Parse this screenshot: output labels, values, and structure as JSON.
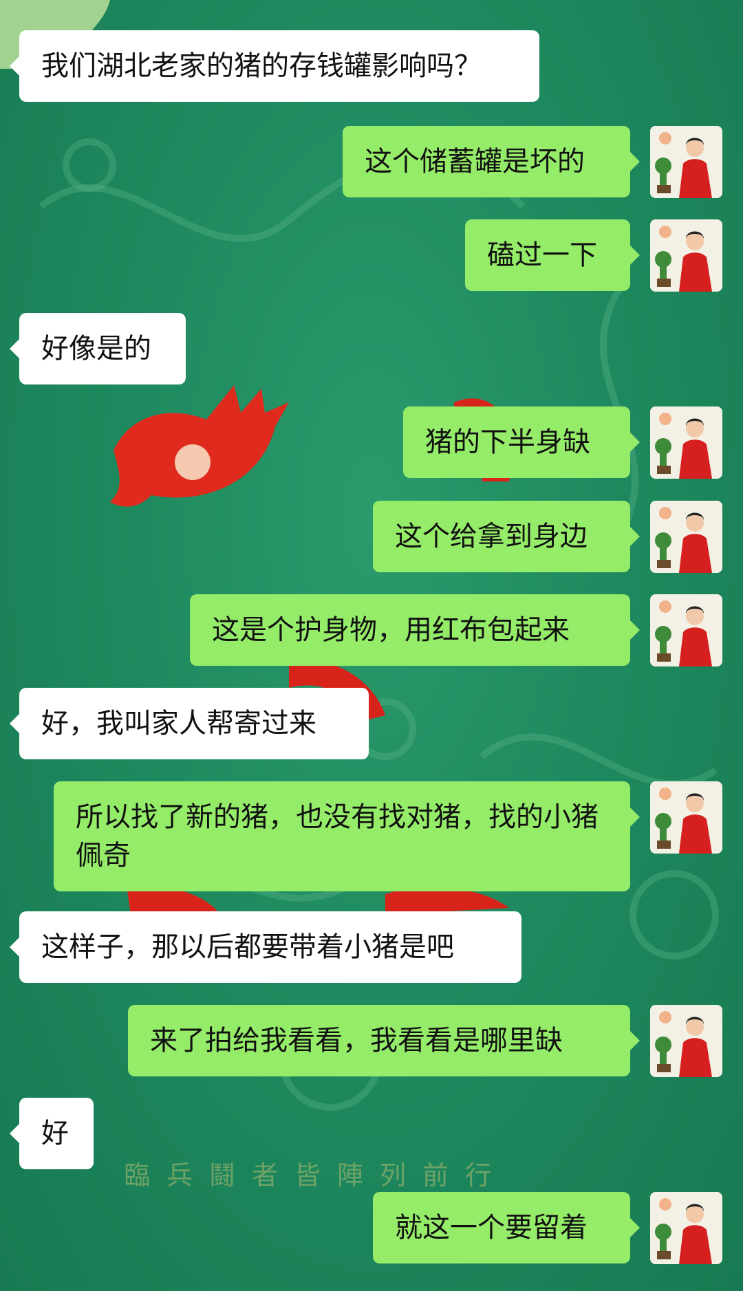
{
  "chat": {
    "messages": [
      {
        "side": "in",
        "text": "我们湖北老家的猪的存钱罐影响吗？"
      },
      {
        "side": "out",
        "text": "这个储蓄罐是坏的"
      },
      {
        "side": "out",
        "text": "磕过一下"
      },
      {
        "side": "in",
        "text": "好像是的"
      },
      {
        "side": "out",
        "text": "猪的下半身缺"
      },
      {
        "side": "out",
        "text": "这个给拿到身边"
      },
      {
        "side": "out",
        "text": "这是个护身物，用红布包起来"
      },
      {
        "side": "in",
        "text": "好，我叫家人帮寄过来"
      },
      {
        "side": "out",
        "text": "所以找了新的猪，也没有找对猪，找的小猪佩奇"
      },
      {
        "side": "in",
        "text": "这样子，那以后都要带着小猪是吧"
      },
      {
        "side": "out",
        "text": "来了拍给我看看，我看看是哪里缺"
      },
      {
        "side": "in",
        "text": "好"
      },
      {
        "side": "out",
        "text": "就这一个要留着"
      }
    ]
  },
  "background": {
    "wallpaper_text": "臨兵鬪者皆陣列前行",
    "bubble_out_color": "#95ec69",
    "bubble_in_color": "#ffffff",
    "wallpaper_color": "#1f8a5f"
  },
  "avatar": {
    "icon": "avatar-woman-red-dress-icon"
  }
}
